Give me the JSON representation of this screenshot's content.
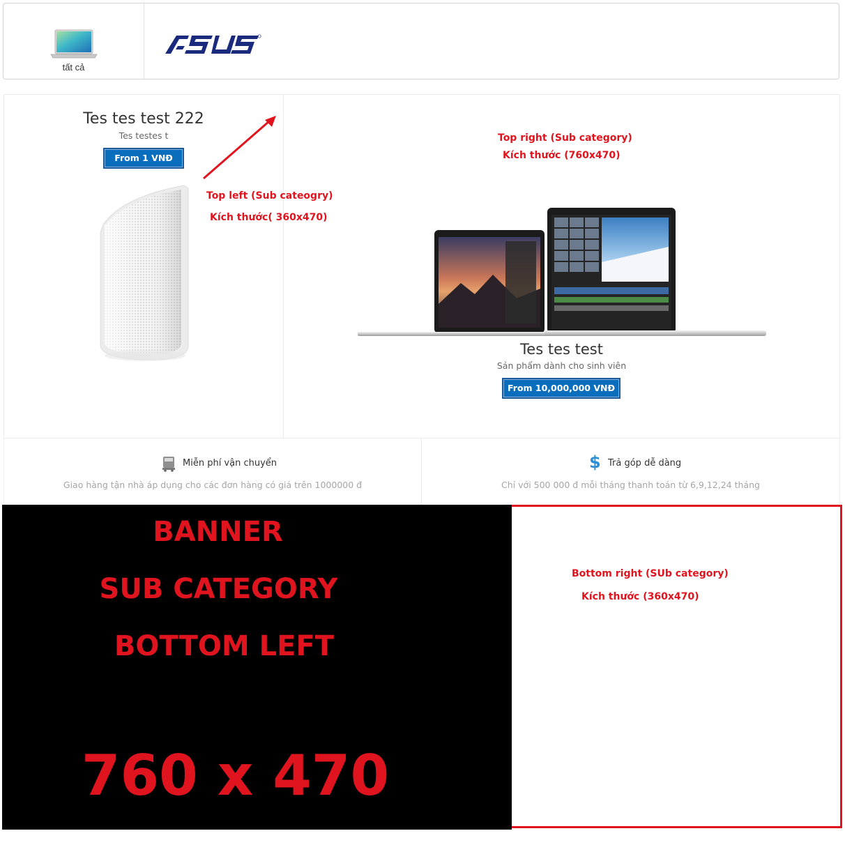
{
  "category_nav": {
    "items": [
      {
        "label": "tất cả",
        "icon": "laptop-icon"
      },
      {
        "label": "ASUS",
        "icon": "asus-logo"
      }
    ]
  },
  "top_left": {
    "title": "Tes tes test 222",
    "subtitle": "Tes testes t",
    "price_button": "From 1 VNĐ",
    "note_line1": "Top left (Sub cateogry)",
    "note_line2": "Kích thước( 360x470)"
  },
  "top_right": {
    "note_line1": "Top right (Sub category)",
    "note_line2": "Kích thước (760x470)",
    "title": "Tes tes test",
    "subtitle": "Sản phẩm dành cho sinh viên",
    "price_button": "From 10,000,000 VNĐ"
  },
  "features": [
    {
      "icon": "truck-icon",
      "title": "Miễn phí vận chuyển",
      "desc": "Giao hàng tận nhà áp dụng cho các đơn hàng có giá trên 1000000 đ"
    },
    {
      "icon": "dollar-icon",
      "title": "Trả góp dễ dàng",
      "desc": "Chỉ với 500 000 đ mỗi tháng thanh toán từ 6,9,12,24 tháng"
    }
  ],
  "bottom_left": {
    "line1": "BANNER",
    "line2": "SUB CATEGORY",
    "line3": "BOTTOM LEFT",
    "size": "760 x 470"
  },
  "bottom_right": {
    "note_line1": "Bottom right (SUb category)",
    "note_line2": "Kích thước (360x470)"
  },
  "colors": {
    "accent_red": "#e0141e",
    "button_blue": "#0b6ebd",
    "asus_navy": "#1a2a7c"
  }
}
